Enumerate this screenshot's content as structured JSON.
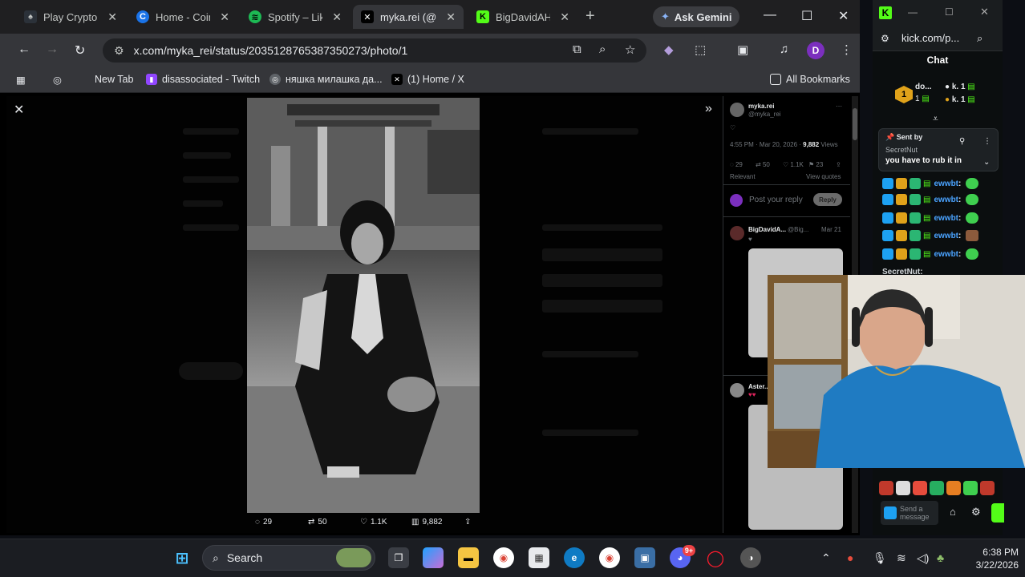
{
  "tabs": [
    {
      "title": "Play Crypto Casino",
      "icon_color": "#2b3139",
      "icon_text": "",
      "active": false
    },
    {
      "title": "Home - CoinGecko",
      "icon_color": "#1a73e8",
      "icon_text": "C",
      "active": false
    },
    {
      "title": "Spotify – Liked Songs",
      "icon_color": "#1db954",
      "icon_text": "≡",
      "active": false
    },
    {
      "title": "myka.rei (@myka_rei)",
      "icon_color": "#000000",
      "icon_text": "𝕏",
      "active": true
    },
    {
      "title": "BigDavidAHH",
      "icon_color": "#53fc18",
      "icon_text": "K",
      "active": false
    }
  ],
  "gemini_label": "Ask Gemini",
  "address": "x.com/myka_rei/status/2035128765387350273/photo/1",
  "profile_initial": "D",
  "bookmarks": [
    {
      "label": "New Tab",
      "icon": "blank-icon",
      "color": "#35363a"
    },
    {
      "label": "disassociated - Twitch",
      "icon": "twitch-icon",
      "color": "#9146ff"
    },
    {
      "label": "няшка милашка да...",
      "icon": "globe-icon",
      "color": "#5f6368"
    },
    {
      "label": "(1) Home / X",
      "icon": "x-icon",
      "color": "#000000"
    }
  ],
  "all_bookmarks": "All Bookmarks",
  "photo_actions": {
    "replies": "29",
    "reposts": "50",
    "likes": "1.1K",
    "views": "9,882"
  },
  "tweet": {
    "author": "myka.rei",
    "handle": "@myka_rei",
    "meta": "4:55 PM · Mar 20, 2026 · ",
    "views": "9,882",
    "views_label": "Views",
    "replies": "29",
    "reposts": "50",
    "likes": "1.1K",
    "bookmarks": "23",
    "relevant": "Relevant",
    "view_quotes": "View quotes",
    "reply_placeholder": "Post your reply",
    "reply_button": "Reply"
  },
  "replies": [
    {
      "author": "BigDavidA...",
      "handle": "@Big...",
      "date": "Mar 21"
    },
    {
      "author": "Aster...",
      "handle": "",
      "date": ""
    }
  ],
  "kick": {
    "url": "kick.com/p...",
    "chat_title": "Chat",
    "leaderboard": [
      {
        "name": "do...",
        "count": "1"
      },
      {
        "name": "k.",
        "count": "1"
      },
      {
        "name": "k.",
        "count": "1"
      }
    ],
    "pinned_by_label": "Sent by",
    "pinned_author": "SecretNut",
    "pinned_text": "you have to rub it in",
    "chat_user": "ewwbt",
    "chat_rows": [
      "ewwbt",
      "ewwbt",
      "ewwbt",
      "ewwbt",
      "ewwbt"
    ],
    "last_user": "SecretNut:",
    "input_placeholder": "Send a message"
  },
  "taskbar": {
    "search": "Search",
    "time": "6:38 PM",
    "date": "3/22/2026",
    "discord_badge": "9+"
  }
}
